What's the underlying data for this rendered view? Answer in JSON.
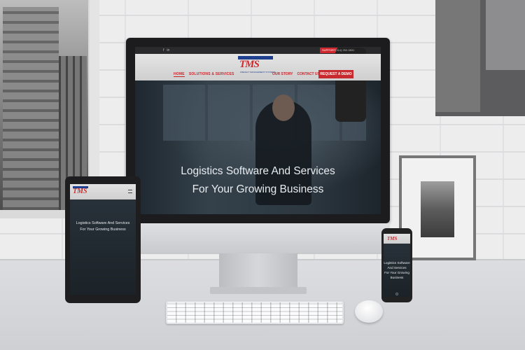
{
  "site": {
    "topbar": {
      "social": [
        "f",
        "in"
      ],
      "support_label": "SUPPORT",
      "phone": "(914) 252-0831"
    },
    "logo": {
      "text": "TMS",
      "tagline": "FREIGHT MANAGEMENT SYSTEMS"
    },
    "nav": {
      "left": [
        "HOME",
        "SOLUTIONS & SERVICES"
      ],
      "right": [
        "OUR STORY",
        "CONTACT US"
      ],
      "cta": "REQUEST A DEMO"
    },
    "hero": {
      "line1": "Logistics Software And Services",
      "line2": "For Your Growing Business"
    }
  },
  "tablet": {
    "logo": "TMS",
    "line1": "Logistics Software And Services",
    "line2": "For Your Growing Business"
  },
  "phone": {
    "logo": "TMS",
    "line1": "Logistics Software",
    "line2": "And Services",
    "line3": "For Your Growing",
    "line4": "Business"
  },
  "colors": {
    "brand_red": "#c92a30",
    "brand_blue": "#1f3f8f",
    "hero_overlay": "#263039"
  }
}
